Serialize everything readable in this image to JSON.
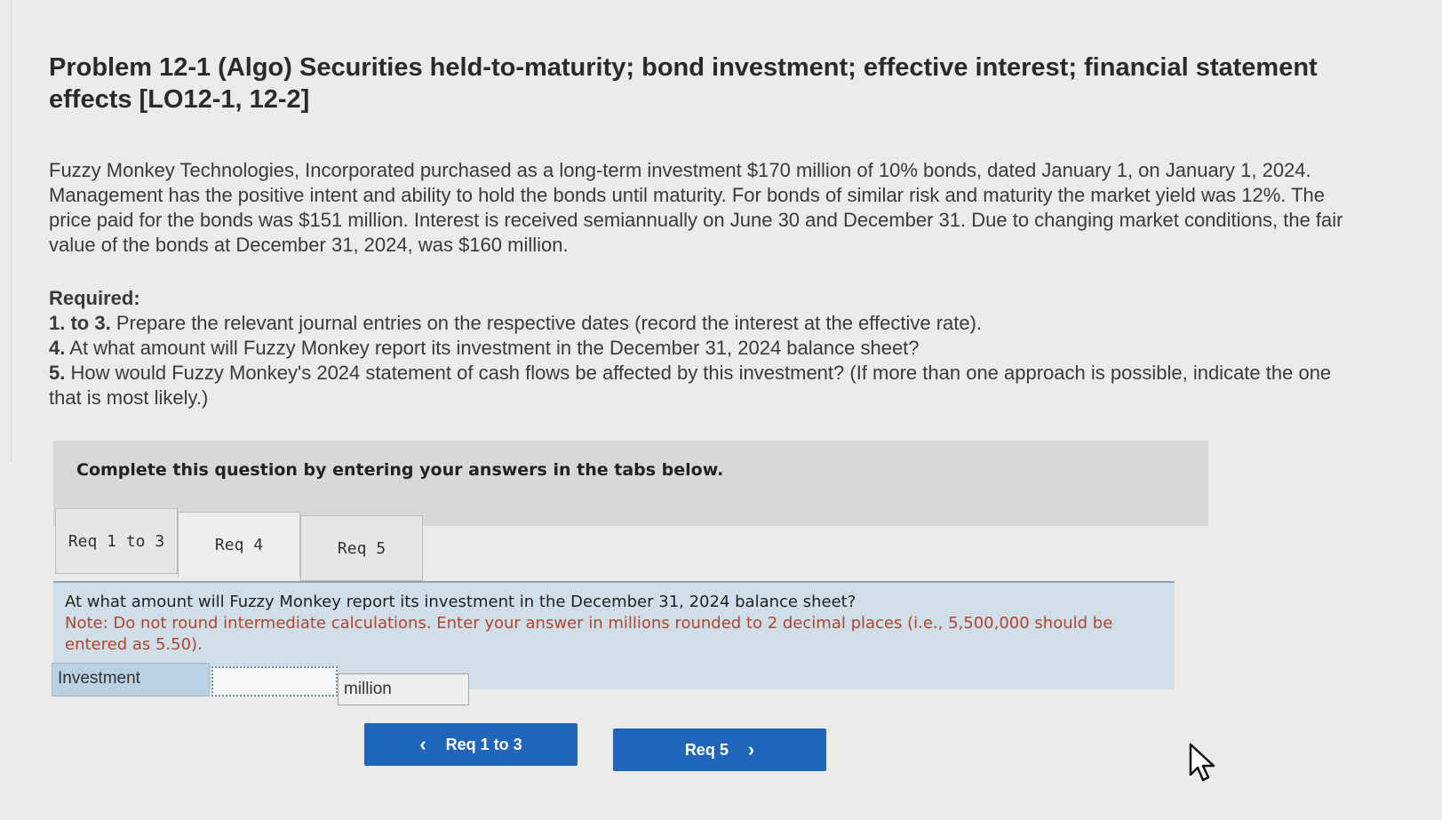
{
  "problem": {
    "title": "Problem 12-1 (Algo) Securities held-to-maturity; bond investment; effective interest; financial statement effects [LO12-1, 12-2]",
    "description": "Fuzzy Monkey Technologies, Incorporated purchased as a long-term investment $170 million of 10% bonds, dated January 1, on January 1, 2024. Management has the positive intent and ability to hold the bonds until maturity. For bonds of similar risk and maturity the market yield was 12%. The price paid for the bonds was $151 million. Interest is received semiannually on June 30 and December 31. Due to changing market conditions, the fair value of the bonds at December 31, 2024, was $160 million."
  },
  "required": {
    "heading": "Required:",
    "items": [
      {
        "num": "1. to 3.",
        "text": "Prepare the relevant journal entries on the respective dates (record the interest at the effective rate)."
      },
      {
        "num": "4.",
        "text": "At what amount will Fuzzy Monkey report its investment in the December 31, 2024 balance sheet?"
      },
      {
        "num": "5.",
        "text": "How would Fuzzy Monkey's 2024 statement of cash flows be affected by this investment? (If more than one approach is possible, indicate the one that is most likely.)"
      }
    ]
  },
  "instruction": "Complete this question by entering your answers in the tabs below.",
  "tabs": [
    {
      "label": "Req 1 to 3",
      "active": false
    },
    {
      "label": "Req 4",
      "active": true
    },
    {
      "label": "Req 5",
      "active": false
    }
  ],
  "question": {
    "text": "At what amount will Fuzzy Monkey report its investment in the December 31, 2024 balance sheet?",
    "note": "Note: Do not round intermediate calculations. Enter your answer in millions rounded to 2 decimal places (i.e., 5,500,000 should be entered as 5.50)."
  },
  "answer": {
    "label": "Investment",
    "value": "",
    "unit": "million"
  },
  "navigation": {
    "prev_label": "Req 1 to 3",
    "next_label": "Req 5"
  },
  "colors": {
    "accent": "#1f66bb",
    "note": "#b2452c",
    "panel": "#cfdee8"
  }
}
